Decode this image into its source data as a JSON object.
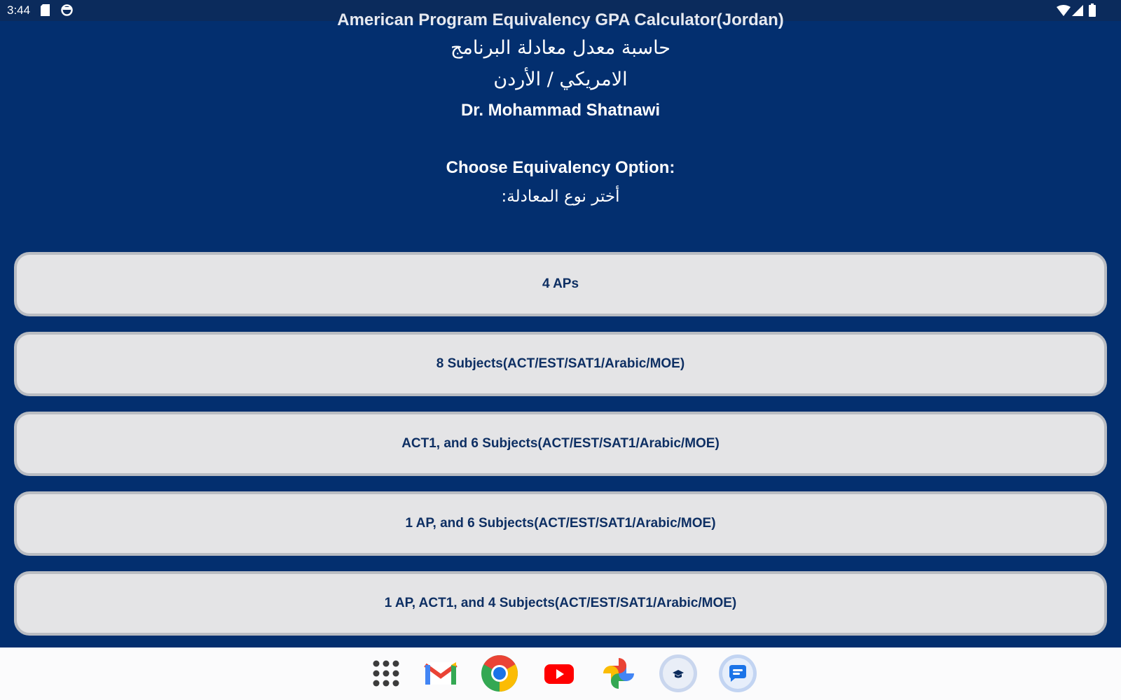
{
  "status_bar": {
    "time": "3:44",
    "left_icons": [
      "sd-card-icon",
      "sync-icon"
    ],
    "right_icons": [
      "wifi-icon",
      "cellular-signal-icon",
      "battery-icon"
    ]
  },
  "header": {
    "title_en": "American Program Equivalency GPA Calculator(Jordan)",
    "title_ar_line1": "حاسبة معدل معادلة البرنامج",
    "title_ar_line2": "الامريكي / الأردن",
    "author": "Dr. Mohammad Shatnawi",
    "prompt_en": "Choose Equivalency Option:",
    "prompt_ar": "أختر نوع المعادلة:"
  },
  "options": [
    {
      "label": "4 APs"
    },
    {
      "label": "8 Subjects(ACT/EST/SAT1/Arabic/MOE)"
    },
    {
      "label": "ACT1, and 6 Subjects(ACT/EST/SAT1/Arabic/MOE)"
    },
    {
      "label": "1 AP, and 6 Subjects(ACT/EST/SAT1/Arabic/MOE)"
    },
    {
      "label": "1 AP, ACT1, and 4 Subjects(ACT/EST/SAT1/Arabic/MOE)"
    }
  ],
  "taskbar": {
    "apps": [
      "app-drawer-icon",
      "gmail-icon",
      "chrome-icon",
      "youtube-icon",
      "photos-icon",
      "gpa-calculator-icon",
      "messages-icon"
    ]
  },
  "colors": {
    "background": "#032f6f",
    "status_bar": "#0b2b5c",
    "button_fill": "#e4e4e6",
    "button_border": "#b9bcc2",
    "button_text": "#0e2f63",
    "taskbar": "#fbfbfc"
  }
}
